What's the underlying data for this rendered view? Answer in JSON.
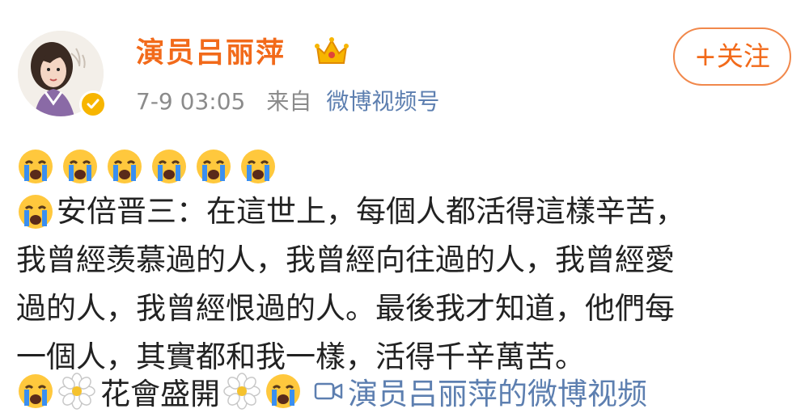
{
  "post": {
    "user_name": "演员吕丽萍",
    "timestamp": "7-9 03:05",
    "source_prefix": "来自",
    "source_name": "微博视频号",
    "follow_label": "+关注",
    "line1": "安倍晋三：在這世上，每個人都活得這樣辛苦，",
    "line2": "我曾經羡慕過的人，我曾經向往過的人，我曾經愛",
    "line3": "過的人，我曾經恨過的人。最後我才知道，他們每",
    "line4": "一個人，其實都和我一樣，活得千辛萬苦。",
    "tag_text": "花會盛開",
    "video_link_label": "演员吕丽萍的微博视频"
  },
  "icons": {
    "avatar": "avatar",
    "verified": "verified-badge-icon",
    "crown": "crown-icon",
    "crying": "crying-face-icon",
    "flower": "white-flower-icon",
    "video": "video-camera-icon"
  },
  "colors": {
    "name": "#f26a1a",
    "link": "#5d7fb0",
    "meta": "#8b8b8b",
    "follow_border": "#f1884b",
    "verified": "#f7b500"
  }
}
